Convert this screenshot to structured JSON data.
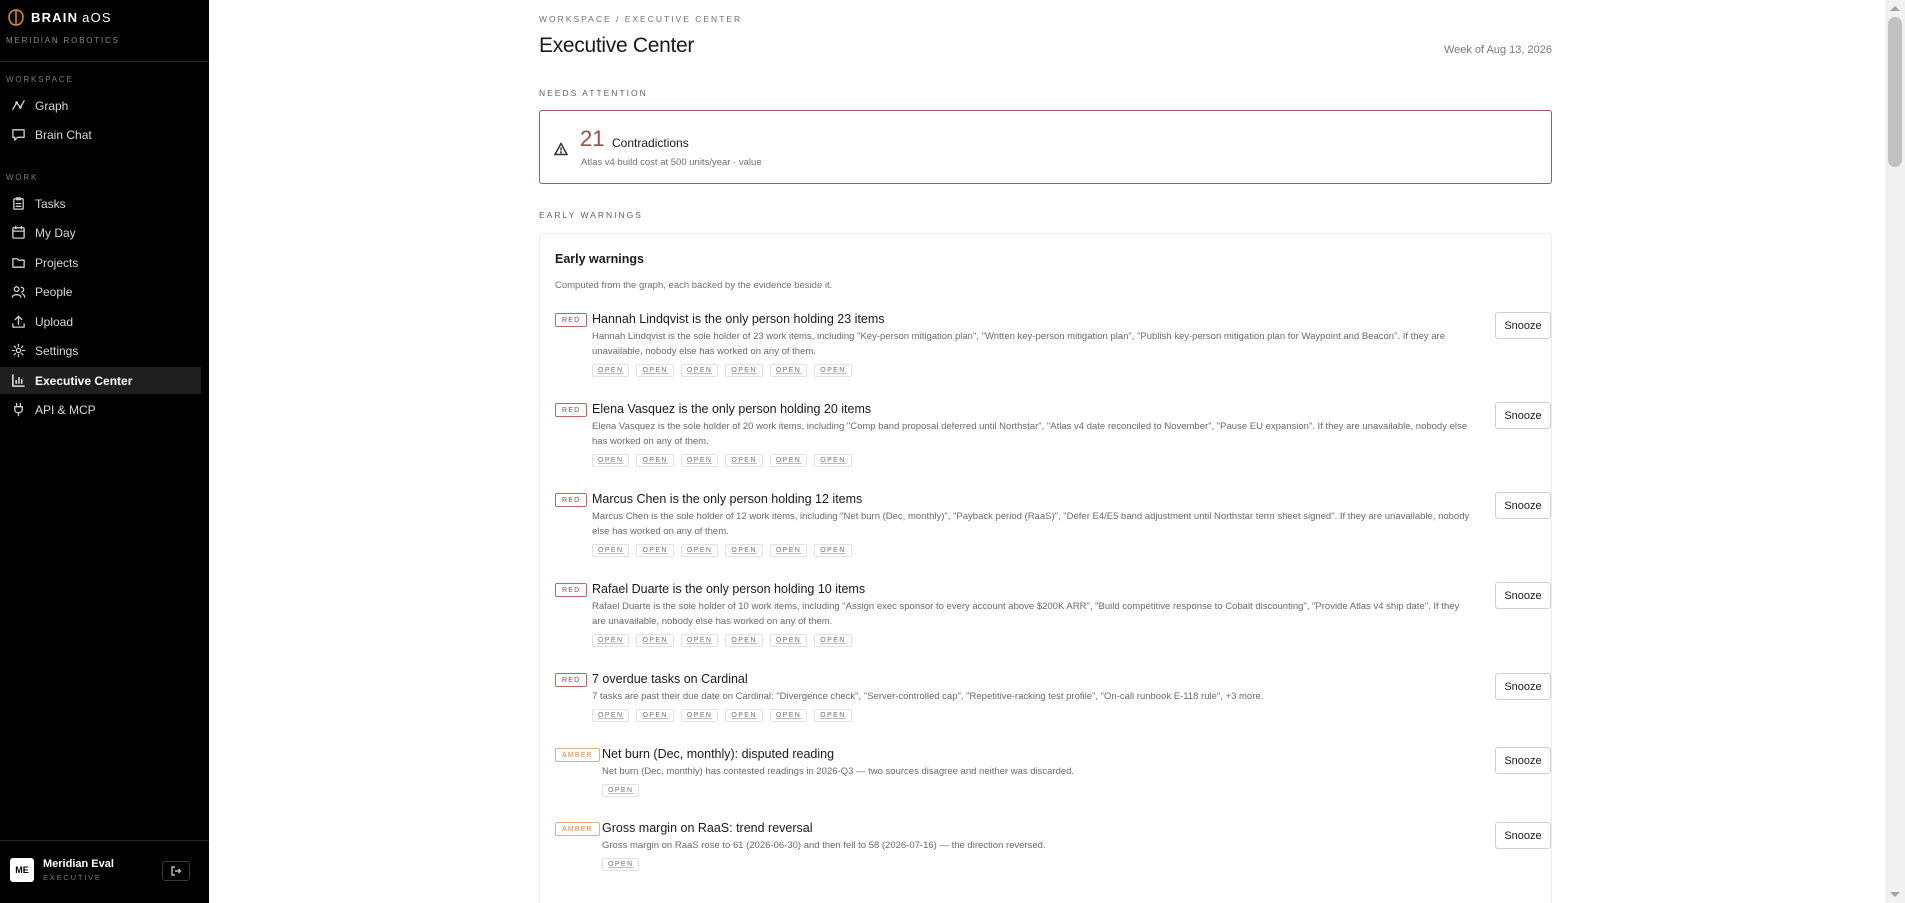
{
  "brand": {
    "name": "BRAIN",
    "suffix": "aOS",
    "org": "MERIDIAN ROBOTICS"
  },
  "sidebar": {
    "sections": [
      {
        "label": "WORKSPACE",
        "items": [
          {
            "label": "Graph",
            "icon": "graph-icon"
          },
          {
            "label": "Brain Chat",
            "icon": "chat-icon"
          }
        ]
      },
      {
        "label": "WORK",
        "items": [
          {
            "label": "Tasks",
            "icon": "clipboard-icon"
          },
          {
            "label": "My Day",
            "icon": "calendar-icon"
          },
          {
            "label": "Projects",
            "icon": "folder-icon"
          },
          {
            "label": "People",
            "icon": "people-icon"
          },
          {
            "label": "Upload",
            "icon": "upload-icon"
          },
          {
            "label": "Settings",
            "icon": "gear-icon"
          },
          {
            "label": "Executive Center",
            "icon": "bar-chart-icon",
            "active": true
          },
          {
            "label": "API & MCP",
            "icon": "plug-icon"
          }
        ]
      }
    ],
    "user": {
      "initials": "ME",
      "name": "Meridian Eval",
      "role": "EXECUTIVE"
    }
  },
  "header": {
    "breadcrumb": "WORKSPACE / EXECUTIVE CENTER",
    "title": "Executive Center",
    "week": "Week of Aug 13, 2026"
  },
  "needs_attention": {
    "label": "NEEDS ATTENTION",
    "count": "21",
    "title": "Contradictions",
    "subtitle": "Atlas v4 build cost at 500 units/year · value"
  },
  "early_warnings": {
    "section_label": "EARLY WARNINGS",
    "title": "Early warnings",
    "subtitle": "Computed from the graph, each backed by the evidence beside it.",
    "snooze_label": "Snooze",
    "items": [
      {
        "severity": "RED",
        "title": "Hannah Lindqvist is the only person holding 23 items",
        "description": "Hannah Lindqvist is the sole holder of 23 work items, including \"Key-person mitigation plan\", \"Written key-person mitigation plan\", \"Publish key-person mitigation plan for Waypoint and Beacon\". If they are unavailable, nobody else has worked on any of them.",
        "tags": [
          "OPEN",
          "OPEN",
          "OPEN",
          "OPEN",
          "OPEN",
          "OPEN"
        ]
      },
      {
        "severity": "RED",
        "title": "Elena Vasquez is the only person holding 20 items",
        "description": "Elena Vasquez is the sole holder of 20 work items, including \"Comp band proposal deferred until Northstar\", \"Atlas v4 date reconciled to November\", \"Pause EU expansion\". If they are unavailable, nobody else has worked on any of them.",
        "tags": [
          "OPEN",
          "OPEN",
          "OPEN",
          "OPEN",
          "OPEN",
          "OPEN"
        ]
      },
      {
        "severity": "RED",
        "title": "Marcus Chen is the only person holding 12 items",
        "description": "Marcus Chen is the sole holder of 12 work items, including \"Net burn (Dec, monthly)\", \"Payback period (RaaS)\", \"Defer E4/E5 band adjustment until Northstar term sheet signed\". If they are unavailable, nobody else has worked on any of them.",
        "tags": [
          "OPEN",
          "OPEN",
          "OPEN",
          "OPEN",
          "OPEN",
          "OPEN"
        ]
      },
      {
        "severity": "RED",
        "title": "Rafael Duarte is the only person holding 10 items",
        "description": "Rafael Duarte is the sole holder of 10 work items, including \"Assign exec sponsor to every account above $200K ARR\", \"Build competitive response to Cobalt discounting\", \"Provide Atlas v4 ship date\". If they are unavailable, nobody else has worked on any of them.",
        "tags": [
          "OPEN",
          "OPEN",
          "OPEN",
          "OPEN",
          "OPEN",
          "OPEN"
        ]
      },
      {
        "severity": "RED",
        "title": "7 overdue tasks on Cardinal",
        "description": "7 tasks are past their due date on Cardinal: \"Divergence check\", \"Server-controlled cap\", \"Repetitive-racking test profile\", \"On-call runbook E-118 rule\", +3 more.",
        "tags": [
          "OPEN",
          "OPEN",
          "OPEN",
          "OPEN",
          "OPEN",
          "OPEN"
        ]
      },
      {
        "severity": "AMBER",
        "title": "Net burn (Dec, monthly): disputed reading",
        "description": "Net burn (Dec, monthly) has contested readings in 2026-Q3 — two sources disagree and neither was discarded.",
        "tags": [
          "OPEN"
        ]
      },
      {
        "severity": "AMBER",
        "title": "Gross margin on RaaS: trend reversal",
        "description": "Gross margin on RaaS rose to 61 (2026-06-30) and then fell to 58 (2026-07-16) — the direction reversed.",
        "tags": [
          "OPEN"
        ]
      }
    ]
  },
  "colors": {
    "red": "#a04040",
    "amber": "#d0884a",
    "sidebar_bg": "#000000"
  }
}
